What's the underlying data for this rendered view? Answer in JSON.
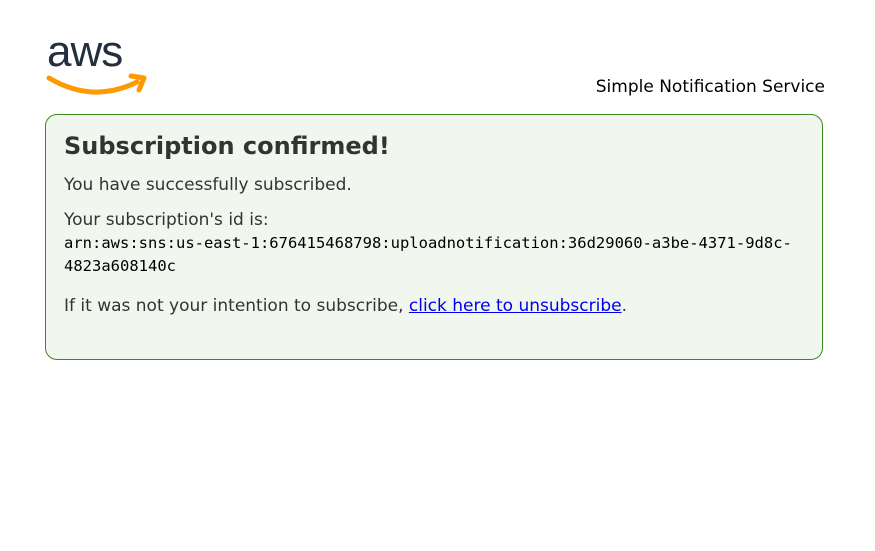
{
  "header": {
    "logo_text": "aws",
    "service_name": "Simple Notification Service"
  },
  "panel": {
    "title": "Subscription confirmed!",
    "success_message": "You have successfully subscribed.",
    "id_label": "Your subscription's id is:",
    "subscription_arn": "arn:aws:sns:us-east-1:676415468798:uploadnotification:36d29060-a3be-4371-9d8c-4823a608140c",
    "unsubscribe_prefix": "If it was not your intention to subscribe, ",
    "unsubscribe_link_label": "click here to unsubscribe",
    "unsubscribe_suffix": "."
  },
  "colors": {
    "panel_border": "#3a8a1e",
    "panel_background": "#f1f6ee",
    "logo_text": "#232f3e",
    "logo_smile": "#ff9900",
    "link": "#0000ee"
  }
}
